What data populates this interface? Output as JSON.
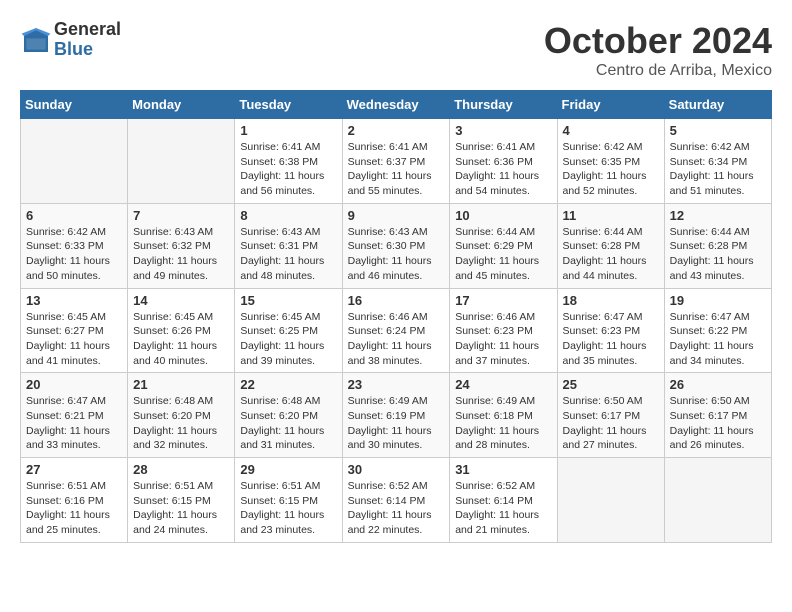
{
  "logo": {
    "general": "General",
    "blue": "Blue"
  },
  "title": "October 2024",
  "location": "Centro de Arriba, Mexico",
  "weekdays": [
    "Sunday",
    "Monday",
    "Tuesday",
    "Wednesday",
    "Thursday",
    "Friday",
    "Saturday"
  ],
  "weeks": [
    [
      {
        "day": "",
        "sunrise": "",
        "sunset": "",
        "daylight": ""
      },
      {
        "day": "",
        "sunrise": "",
        "sunset": "",
        "daylight": ""
      },
      {
        "day": "1",
        "sunrise": "Sunrise: 6:41 AM",
        "sunset": "Sunset: 6:38 PM",
        "daylight": "Daylight: 11 hours and 56 minutes."
      },
      {
        "day": "2",
        "sunrise": "Sunrise: 6:41 AM",
        "sunset": "Sunset: 6:37 PM",
        "daylight": "Daylight: 11 hours and 55 minutes."
      },
      {
        "day": "3",
        "sunrise": "Sunrise: 6:41 AM",
        "sunset": "Sunset: 6:36 PM",
        "daylight": "Daylight: 11 hours and 54 minutes."
      },
      {
        "day": "4",
        "sunrise": "Sunrise: 6:42 AM",
        "sunset": "Sunset: 6:35 PM",
        "daylight": "Daylight: 11 hours and 52 minutes."
      },
      {
        "day": "5",
        "sunrise": "Sunrise: 6:42 AM",
        "sunset": "Sunset: 6:34 PM",
        "daylight": "Daylight: 11 hours and 51 minutes."
      }
    ],
    [
      {
        "day": "6",
        "sunrise": "Sunrise: 6:42 AM",
        "sunset": "Sunset: 6:33 PM",
        "daylight": "Daylight: 11 hours and 50 minutes."
      },
      {
        "day": "7",
        "sunrise": "Sunrise: 6:43 AM",
        "sunset": "Sunset: 6:32 PM",
        "daylight": "Daylight: 11 hours and 49 minutes."
      },
      {
        "day": "8",
        "sunrise": "Sunrise: 6:43 AM",
        "sunset": "Sunset: 6:31 PM",
        "daylight": "Daylight: 11 hours and 48 minutes."
      },
      {
        "day": "9",
        "sunrise": "Sunrise: 6:43 AM",
        "sunset": "Sunset: 6:30 PM",
        "daylight": "Daylight: 11 hours and 46 minutes."
      },
      {
        "day": "10",
        "sunrise": "Sunrise: 6:44 AM",
        "sunset": "Sunset: 6:29 PM",
        "daylight": "Daylight: 11 hours and 45 minutes."
      },
      {
        "day": "11",
        "sunrise": "Sunrise: 6:44 AM",
        "sunset": "Sunset: 6:28 PM",
        "daylight": "Daylight: 11 hours and 44 minutes."
      },
      {
        "day": "12",
        "sunrise": "Sunrise: 6:44 AM",
        "sunset": "Sunset: 6:28 PM",
        "daylight": "Daylight: 11 hours and 43 minutes."
      }
    ],
    [
      {
        "day": "13",
        "sunrise": "Sunrise: 6:45 AM",
        "sunset": "Sunset: 6:27 PM",
        "daylight": "Daylight: 11 hours and 41 minutes."
      },
      {
        "day": "14",
        "sunrise": "Sunrise: 6:45 AM",
        "sunset": "Sunset: 6:26 PM",
        "daylight": "Daylight: 11 hours and 40 minutes."
      },
      {
        "day": "15",
        "sunrise": "Sunrise: 6:45 AM",
        "sunset": "Sunset: 6:25 PM",
        "daylight": "Daylight: 11 hours and 39 minutes."
      },
      {
        "day": "16",
        "sunrise": "Sunrise: 6:46 AM",
        "sunset": "Sunset: 6:24 PM",
        "daylight": "Daylight: 11 hours and 38 minutes."
      },
      {
        "day": "17",
        "sunrise": "Sunrise: 6:46 AM",
        "sunset": "Sunset: 6:23 PM",
        "daylight": "Daylight: 11 hours and 37 minutes."
      },
      {
        "day": "18",
        "sunrise": "Sunrise: 6:47 AM",
        "sunset": "Sunset: 6:23 PM",
        "daylight": "Daylight: 11 hours and 35 minutes."
      },
      {
        "day": "19",
        "sunrise": "Sunrise: 6:47 AM",
        "sunset": "Sunset: 6:22 PM",
        "daylight": "Daylight: 11 hours and 34 minutes."
      }
    ],
    [
      {
        "day": "20",
        "sunrise": "Sunrise: 6:47 AM",
        "sunset": "Sunset: 6:21 PM",
        "daylight": "Daylight: 11 hours and 33 minutes."
      },
      {
        "day": "21",
        "sunrise": "Sunrise: 6:48 AM",
        "sunset": "Sunset: 6:20 PM",
        "daylight": "Daylight: 11 hours and 32 minutes."
      },
      {
        "day": "22",
        "sunrise": "Sunrise: 6:48 AM",
        "sunset": "Sunset: 6:20 PM",
        "daylight": "Daylight: 11 hours and 31 minutes."
      },
      {
        "day": "23",
        "sunrise": "Sunrise: 6:49 AM",
        "sunset": "Sunset: 6:19 PM",
        "daylight": "Daylight: 11 hours and 30 minutes."
      },
      {
        "day": "24",
        "sunrise": "Sunrise: 6:49 AM",
        "sunset": "Sunset: 6:18 PM",
        "daylight": "Daylight: 11 hours and 28 minutes."
      },
      {
        "day": "25",
        "sunrise": "Sunrise: 6:50 AM",
        "sunset": "Sunset: 6:17 PM",
        "daylight": "Daylight: 11 hours and 27 minutes."
      },
      {
        "day": "26",
        "sunrise": "Sunrise: 6:50 AM",
        "sunset": "Sunset: 6:17 PM",
        "daylight": "Daylight: 11 hours and 26 minutes."
      }
    ],
    [
      {
        "day": "27",
        "sunrise": "Sunrise: 6:51 AM",
        "sunset": "Sunset: 6:16 PM",
        "daylight": "Daylight: 11 hours and 25 minutes."
      },
      {
        "day": "28",
        "sunrise": "Sunrise: 6:51 AM",
        "sunset": "Sunset: 6:15 PM",
        "daylight": "Daylight: 11 hours and 24 minutes."
      },
      {
        "day": "29",
        "sunrise": "Sunrise: 6:51 AM",
        "sunset": "Sunset: 6:15 PM",
        "daylight": "Daylight: 11 hours and 23 minutes."
      },
      {
        "day": "30",
        "sunrise": "Sunrise: 6:52 AM",
        "sunset": "Sunset: 6:14 PM",
        "daylight": "Daylight: 11 hours and 22 minutes."
      },
      {
        "day": "31",
        "sunrise": "Sunrise: 6:52 AM",
        "sunset": "Sunset: 6:14 PM",
        "daylight": "Daylight: 11 hours and 21 minutes."
      },
      {
        "day": "",
        "sunrise": "",
        "sunset": "",
        "daylight": ""
      },
      {
        "day": "",
        "sunrise": "",
        "sunset": "",
        "daylight": ""
      }
    ]
  ]
}
